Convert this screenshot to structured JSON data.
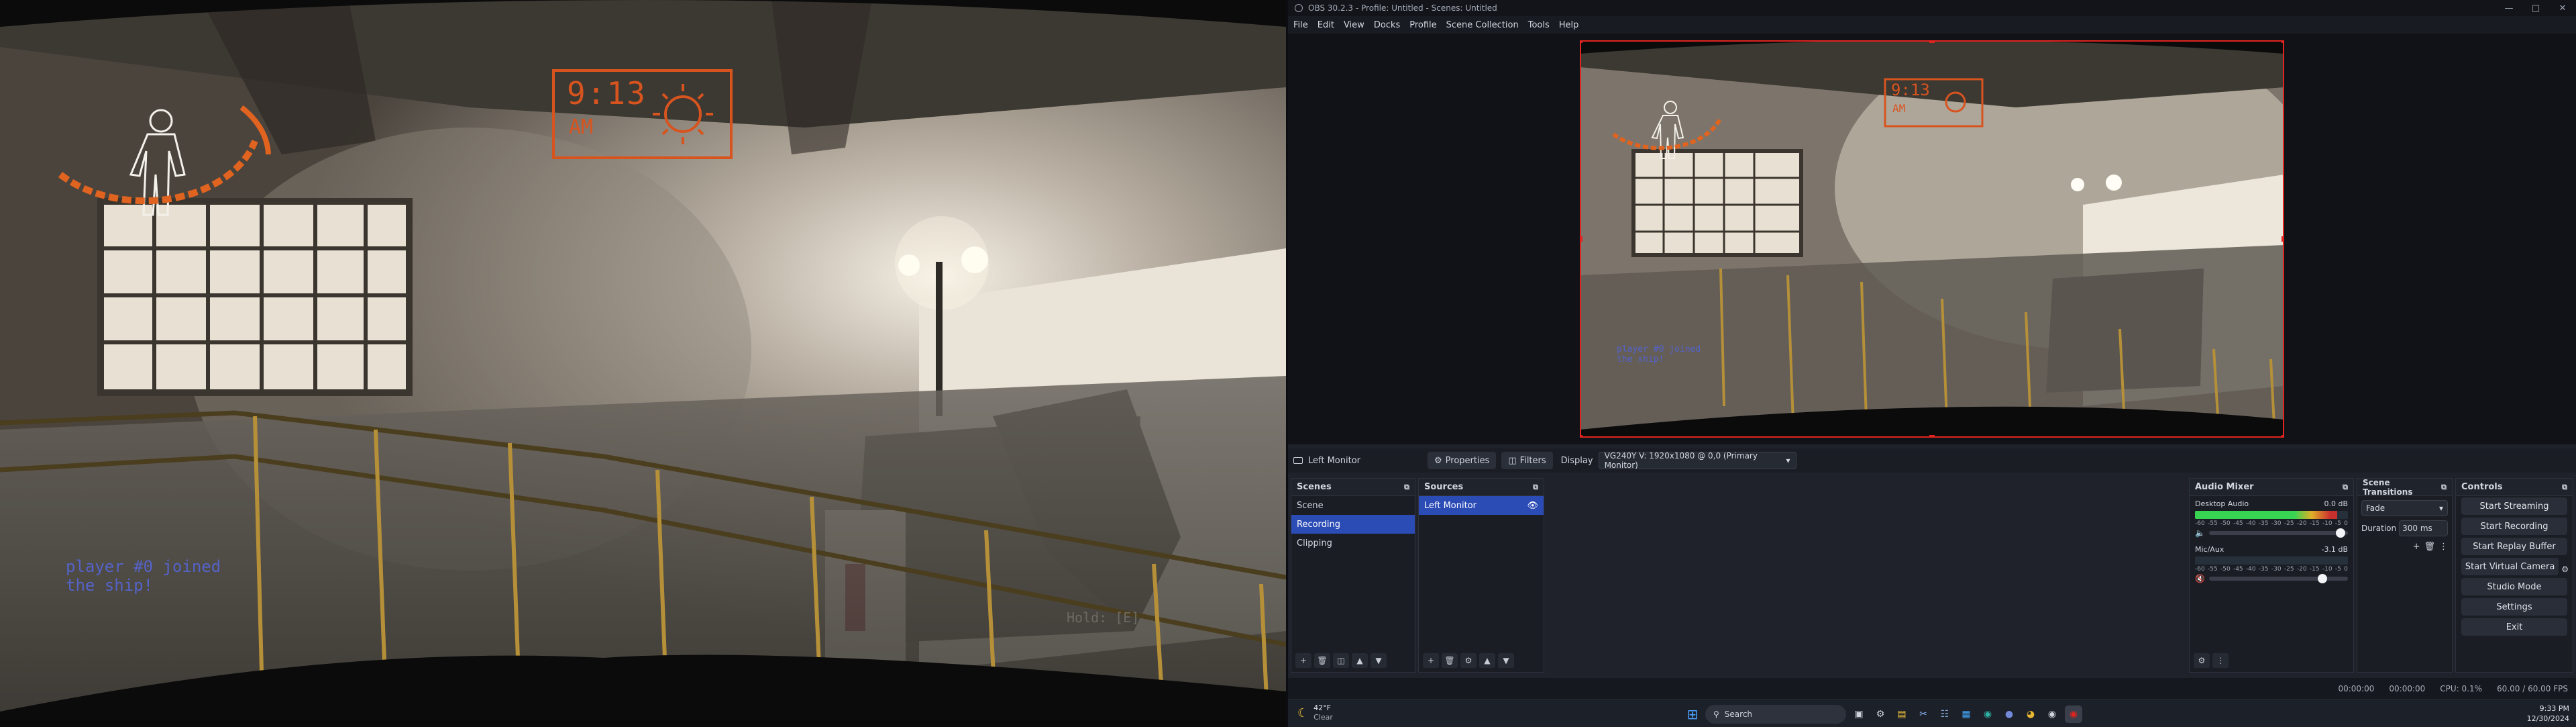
{
  "game": {
    "clock_time": "9:13",
    "clock_ampm": "AM",
    "chat_line1": "player #0 joined",
    "chat_line2": "the ship!",
    "hint_text": "Hold: [E]"
  },
  "obs": {
    "title": "OBS 30.2.3 - Profile: Untitled - Scenes: Untitled",
    "menu": [
      "File",
      "Edit",
      "View",
      "Docks",
      "Profile",
      "Scene Collection",
      "Tools",
      "Help"
    ],
    "source_bar": {
      "current_source": "Left Monitor",
      "properties_label": "Properties",
      "filters_label": "Filters",
      "display_label": "Display",
      "display_value": "VG240Y V: 1920x1080 @ 0,0 (Primary Monitor)"
    },
    "scenes": {
      "title": "Scenes",
      "items": [
        "Scene",
        "Recording",
        "Clipping"
      ],
      "selected": 1
    },
    "sources": {
      "title": "Sources",
      "items": [
        "Left Monitor"
      ]
    },
    "mixer": {
      "title": "Audio Mixer",
      "tracks": [
        {
          "name": "Desktop Audio",
          "db": "0.0 dB",
          "level": 0.93,
          "volume": 0.98
        },
        {
          "name": "Mic/Aux",
          "db": "-3.1 dB",
          "level": 0.0,
          "volume": 0.85
        }
      ],
      "scale": [
        "-60",
        "-55",
        "-50",
        "-45",
        "-40",
        "-35",
        "-30",
        "-25",
        "-20",
        "-15",
        "-10",
        "-5",
        "0"
      ]
    },
    "transitions": {
      "title": "Scene Transitions",
      "type": "Fade",
      "duration_label": "Duration",
      "duration_value": "300 ms"
    },
    "controls": {
      "title": "Controls",
      "buttons": [
        "Start Streaming",
        "Start Recording",
        "Start Replay Buffer",
        "Start Virtual Camera",
        "Studio Mode",
        "Settings",
        "Exit"
      ]
    },
    "status": {
      "rec_time": "00:00:00",
      "stream_time": "00:00:00",
      "cpu": "CPU: 0.1%",
      "fps": "60.00 / 60.00 FPS"
    }
  },
  "taskbar": {
    "weather_temp": "42°F",
    "weather_desc": "Clear",
    "search_placeholder": "Search",
    "time": "9:33 PM",
    "date": "12/30/2024"
  },
  "colors": {
    "accent": "#2b4bb5",
    "hud_orange": "#e0631f",
    "meter_green": "#39d353",
    "meter_yellow": "#e0b028",
    "meter_red": "#c8302e"
  }
}
